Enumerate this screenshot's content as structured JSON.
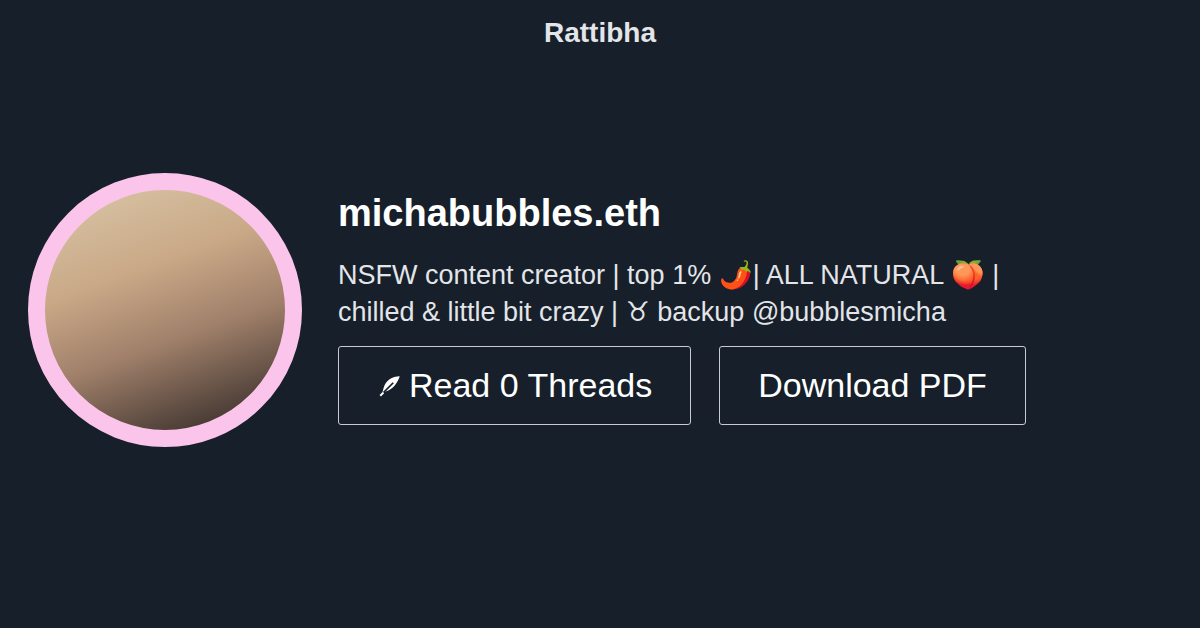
{
  "site": {
    "title": "Rattibha"
  },
  "profile": {
    "handle": "michabubbles.eth",
    "bio": [
      "NSFW content creator | top 1% 🌶️| ALL NATURAL 🍑 |",
      "chilled & little bit crazy | ♉ backup @bubblesmicha"
    ]
  },
  "buttons": [
    {
      "label": "Read 0 Threads",
      "kind": "threads"
    },
    {
      "label": "Download PDF",
      "kind": "pdf"
    }
  ]
}
